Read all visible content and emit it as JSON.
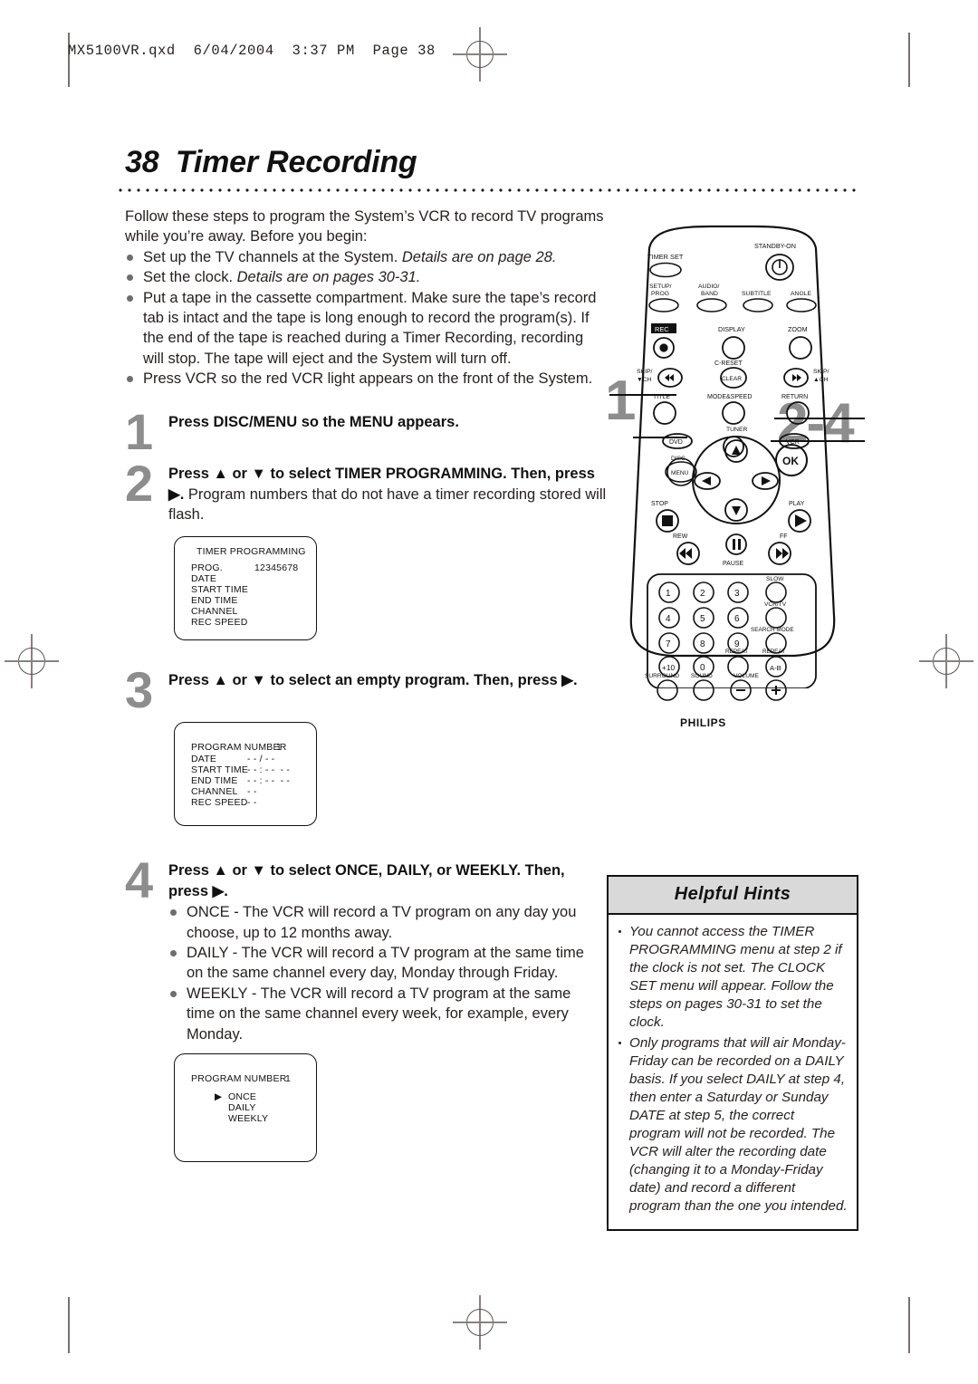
{
  "header": {
    "file_line": "MX5100VR.qxd  6/04/2004  3:37 PM  Page 38"
  },
  "title": {
    "number": "38",
    "text": "Timer Recording",
    "full": "38  Timer Recording"
  },
  "intro": {
    "paragraph": "Follow these steps to program the System’s VCR to record TV programs while you’re away. Before you begin:",
    "bullets": [
      {
        "text": "Set up the TV channels at the System. ",
        "italic": "Details are on page 28."
      },
      {
        "text": "Set the clock. ",
        "italic": "Details are on pages 30-31."
      },
      {
        "text": "Put a tape in the cassette compartment. Make sure the tape’s record tab is intact and the tape is long enough to record the program(s). If the end of the tape is reached during a Timer Recording, recording will stop. The tape will eject and the System will turn off.",
        "italic": ""
      },
      {
        "text": "Press VCR so the red VCR light appears on the front of the System.",
        "italic": ""
      }
    ]
  },
  "steps": [
    {
      "number": "1",
      "bold": "Press DISC/MENU so the MENU appears.",
      "rest": ""
    },
    {
      "number": "2",
      "bold": "Press ▲ or ▼ to select TIMER PROGRAMMING. Then, press ▶.",
      "rest": " Program numbers that do not have a timer recording stored will flash."
    },
    {
      "number": "3",
      "bold": "Press ▲ or ▼ to select an empty program. Then, press ▶.",
      "rest": ""
    },
    {
      "number": "4",
      "bold": "Press ▲ or ▼ to select ONCE, DAILY, or WEEKLY. Then, press ▶.",
      "rest": ""
    }
  ],
  "step4_bullets": [
    "ONCE - The VCR will record a TV program on any day you choose, up to 12 months away.",
    "DAILY - The VCR will record a TV program at the same time on the same channel every day, Monday through Friday.",
    "WEEKLY - The VCR will record a TV program at the same time on the same channel every week, for example, every Monday."
  ],
  "osd_menus": [
    {
      "name": "timer-programming-menu",
      "title": "TIMER PROGRAMMING",
      "rows": [
        {
          "label": "PROG.",
          "value": "12345678"
        },
        {
          "label": "DATE",
          "value": ""
        },
        {
          "label": "START TIME",
          "value": ""
        },
        {
          "label": "END TIME",
          "value": ""
        },
        {
          "label": "CHANNEL",
          "value": ""
        },
        {
          "label": "REC SPEED",
          "value": ""
        }
      ]
    },
    {
      "name": "program-number-menu",
      "title": "",
      "rows": [
        {
          "label": "PROGRAM NUMBER",
          "value": "1"
        },
        {
          "label": "DATE",
          "value": "- - / - -"
        },
        {
          "label": "START TIME",
          "value": "- - : - -  - -"
        },
        {
          "label": "END TIME",
          "value": "- - : - -  - -"
        },
        {
          "label": "CHANNEL",
          "value": "- -"
        },
        {
          "label": "REC SPEED",
          "value": "- -"
        }
      ]
    },
    {
      "name": "frequency-select-menu",
      "title": "",
      "heading": "PROGRAM NUMBER",
      "heading_value": "1",
      "options": [
        "ONCE",
        "DAILY",
        "WEEKLY"
      ],
      "selected_marker": "▶",
      "selected": "ONCE"
    }
  ],
  "hints": {
    "heading": "Helpful Hints",
    "items": [
      "You cannot access the TIMER PROGRAMMING menu at step 2 if the clock is not set. The CLOCK SET menu will appear. Follow the steps on pages 30-31 to set the clock.",
      "Only programs that will air Monday-Friday can be recorded on a DAILY basis. If you select DAILY at step 4, then enter a Saturday or Sunday DATE at step 5, the correct program will not be recorded. The VCR will alter the recording date (changing it to a Monday-Friday date) and record a different program than the one you intended."
    ]
  },
  "remote": {
    "brand": "PHILIPS",
    "callout_left": "1",
    "callout_right": "2-4",
    "labels": {
      "timer_set": "TIMER SET",
      "standby_on": "STANDBY-ON",
      "setup_prog": "SETUP/\nPROG",
      "audio_band": "AUDIO/\nBAND",
      "subtitle": "SUBTITLE",
      "angle": "ANGLE",
      "rec": "REC",
      "display": "DISPLAY",
      "zoom": "ZOOM",
      "skip_down": "SKIP/\n▼CH",
      "c_reset": "C-RESET",
      "clear": "CLEAR",
      "skip_up": "SKIP/\n▲CH",
      "title": "TITLE",
      "mode_speed": "MODE&SPEED",
      "return": "RETURN",
      "dvd": "DVD",
      "tuner": "TUNER",
      "vcr": "VCR",
      "disc": "DISC",
      "menu": "MENU",
      "ok": "OK",
      "stop": "STOP",
      "play": "PLAY",
      "rew": "REW",
      "pause": "PAUSE",
      "ff": "FF",
      "slow": "SLOW",
      "vcr_tv": "VCR/TV",
      "search_mode": "SEARCH MODE",
      "repeat": "REPEAT",
      "repeat_ab": "REPEAT\nA-B",
      "ab": "A-B",
      "surround": "SURROUND",
      "sound": "SOUND",
      "volume": "VOLUME",
      "keys": [
        "1",
        "2",
        "3",
        "4",
        "5",
        "6",
        "7",
        "8",
        "9",
        "+10",
        "0"
      ],
      "vol_minus": "−",
      "vol_plus": "+"
    }
  },
  "colors": {
    "text": "#25211f",
    "step_number": "#8d8d8d",
    "hint_header_bg": "#d9d9d9",
    "bullet": "#6d6d6d"
  }
}
